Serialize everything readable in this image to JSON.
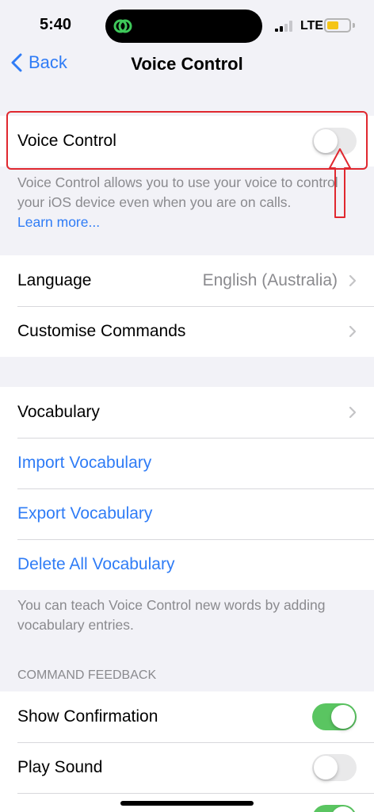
{
  "status_bar": {
    "time": "5:40",
    "network": "LTE",
    "battery_level": 0.55,
    "battery_color": "#f5c518"
  },
  "nav": {
    "back_label": "Back",
    "title": "Voice Control"
  },
  "main_toggle": {
    "label": "Voice Control",
    "on": false
  },
  "voice_control_footer": {
    "text": "Voice Control allows you to use your voice to control your iOS device even when you are on calls.",
    "link": "Learn more..."
  },
  "settings": {
    "language_label": "Language",
    "language_value": "English (Australia)",
    "customise_label": "Customise Commands"
  },
  "vocabulary": {
    "vocabulary_label": "Vocabulary",
    "import_label": "Import Vocabulary",
    "export_label": "Export Vocabulary",
    "delete_label": "Delete All Vocabulary",
    "footer": "You can teach Voice Control new words by adding vocabulary entries."
  },
  "command_feedback": {
    "header": "COMMAND FEEDBACK",
    "show_confirmation_label": "Show Confirmation",
    "show_confirmation_on": true,
    "play_sound_label": "Play Sound",
    "play_sound_on": false,
    "third_toggle_on": true
  },
  "colors": {
    "accent": "#2f7cf6",
    "toggle_on": "#5ac561",
    "highlight": "#e0282f"
  }
}
